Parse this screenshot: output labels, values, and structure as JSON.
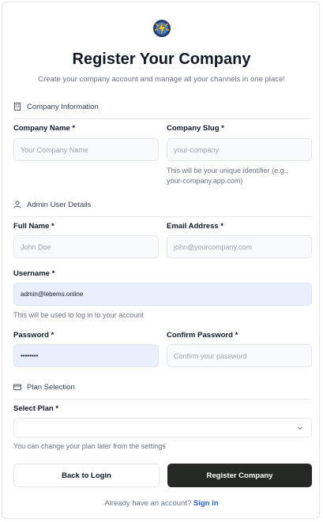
{
  "header": {
    "title": "Register Your Company",
    "subtitle": "Create your company account and manage all your channels in one place!"
  },
  "sections": {
    "company": "Company Information",
    "admin": "Admin User Details",
    "plan": "Plan Selection"
  },
  "company": {
    "name_label": "Company Name *",
    "name_placeholder": "Your Company Name",
    "slug_label": "Company Slug *",
    "slug_placeholder": "your-company",
    "slug_help_1": "This will be your unique identifier (e.g.,",
    "slug_help_2": "your-company.app.com)"
  },
  "admin": {
    "full_name_label": "Full Name *",
    "full_name_placeholder": "John Doe",
    "email_label": "Email Address *",
    "email_placeholder": "john@yourcompany.com",
    "username_label": "Username *",
    "username_value": "admin@lebems.online",
    "username_help": "This will be used to log in to your account",
    "password_label": "Password *",
    "password_value": "••••••••",
    "confirm_label": "Confirm Password *",
    "confirm_placeholder": "Confirm your password"
  },
  "plan": {
    "label": "Select Plan *",
    "selected": "",
    "help": "You can change your plan later from the settings"
  },
  "buttons": {
    "back": "Back to Login",
    "register": "Register Company"
  },
  "footer": {
    "prompt": "Already have an account?",
    "link": "Sign in"
  },
  "colors": {
    "accent_link": "#2563eb",
    "primary_button": "#262826",
    "filled_field": "#e8effd"
  }
}
